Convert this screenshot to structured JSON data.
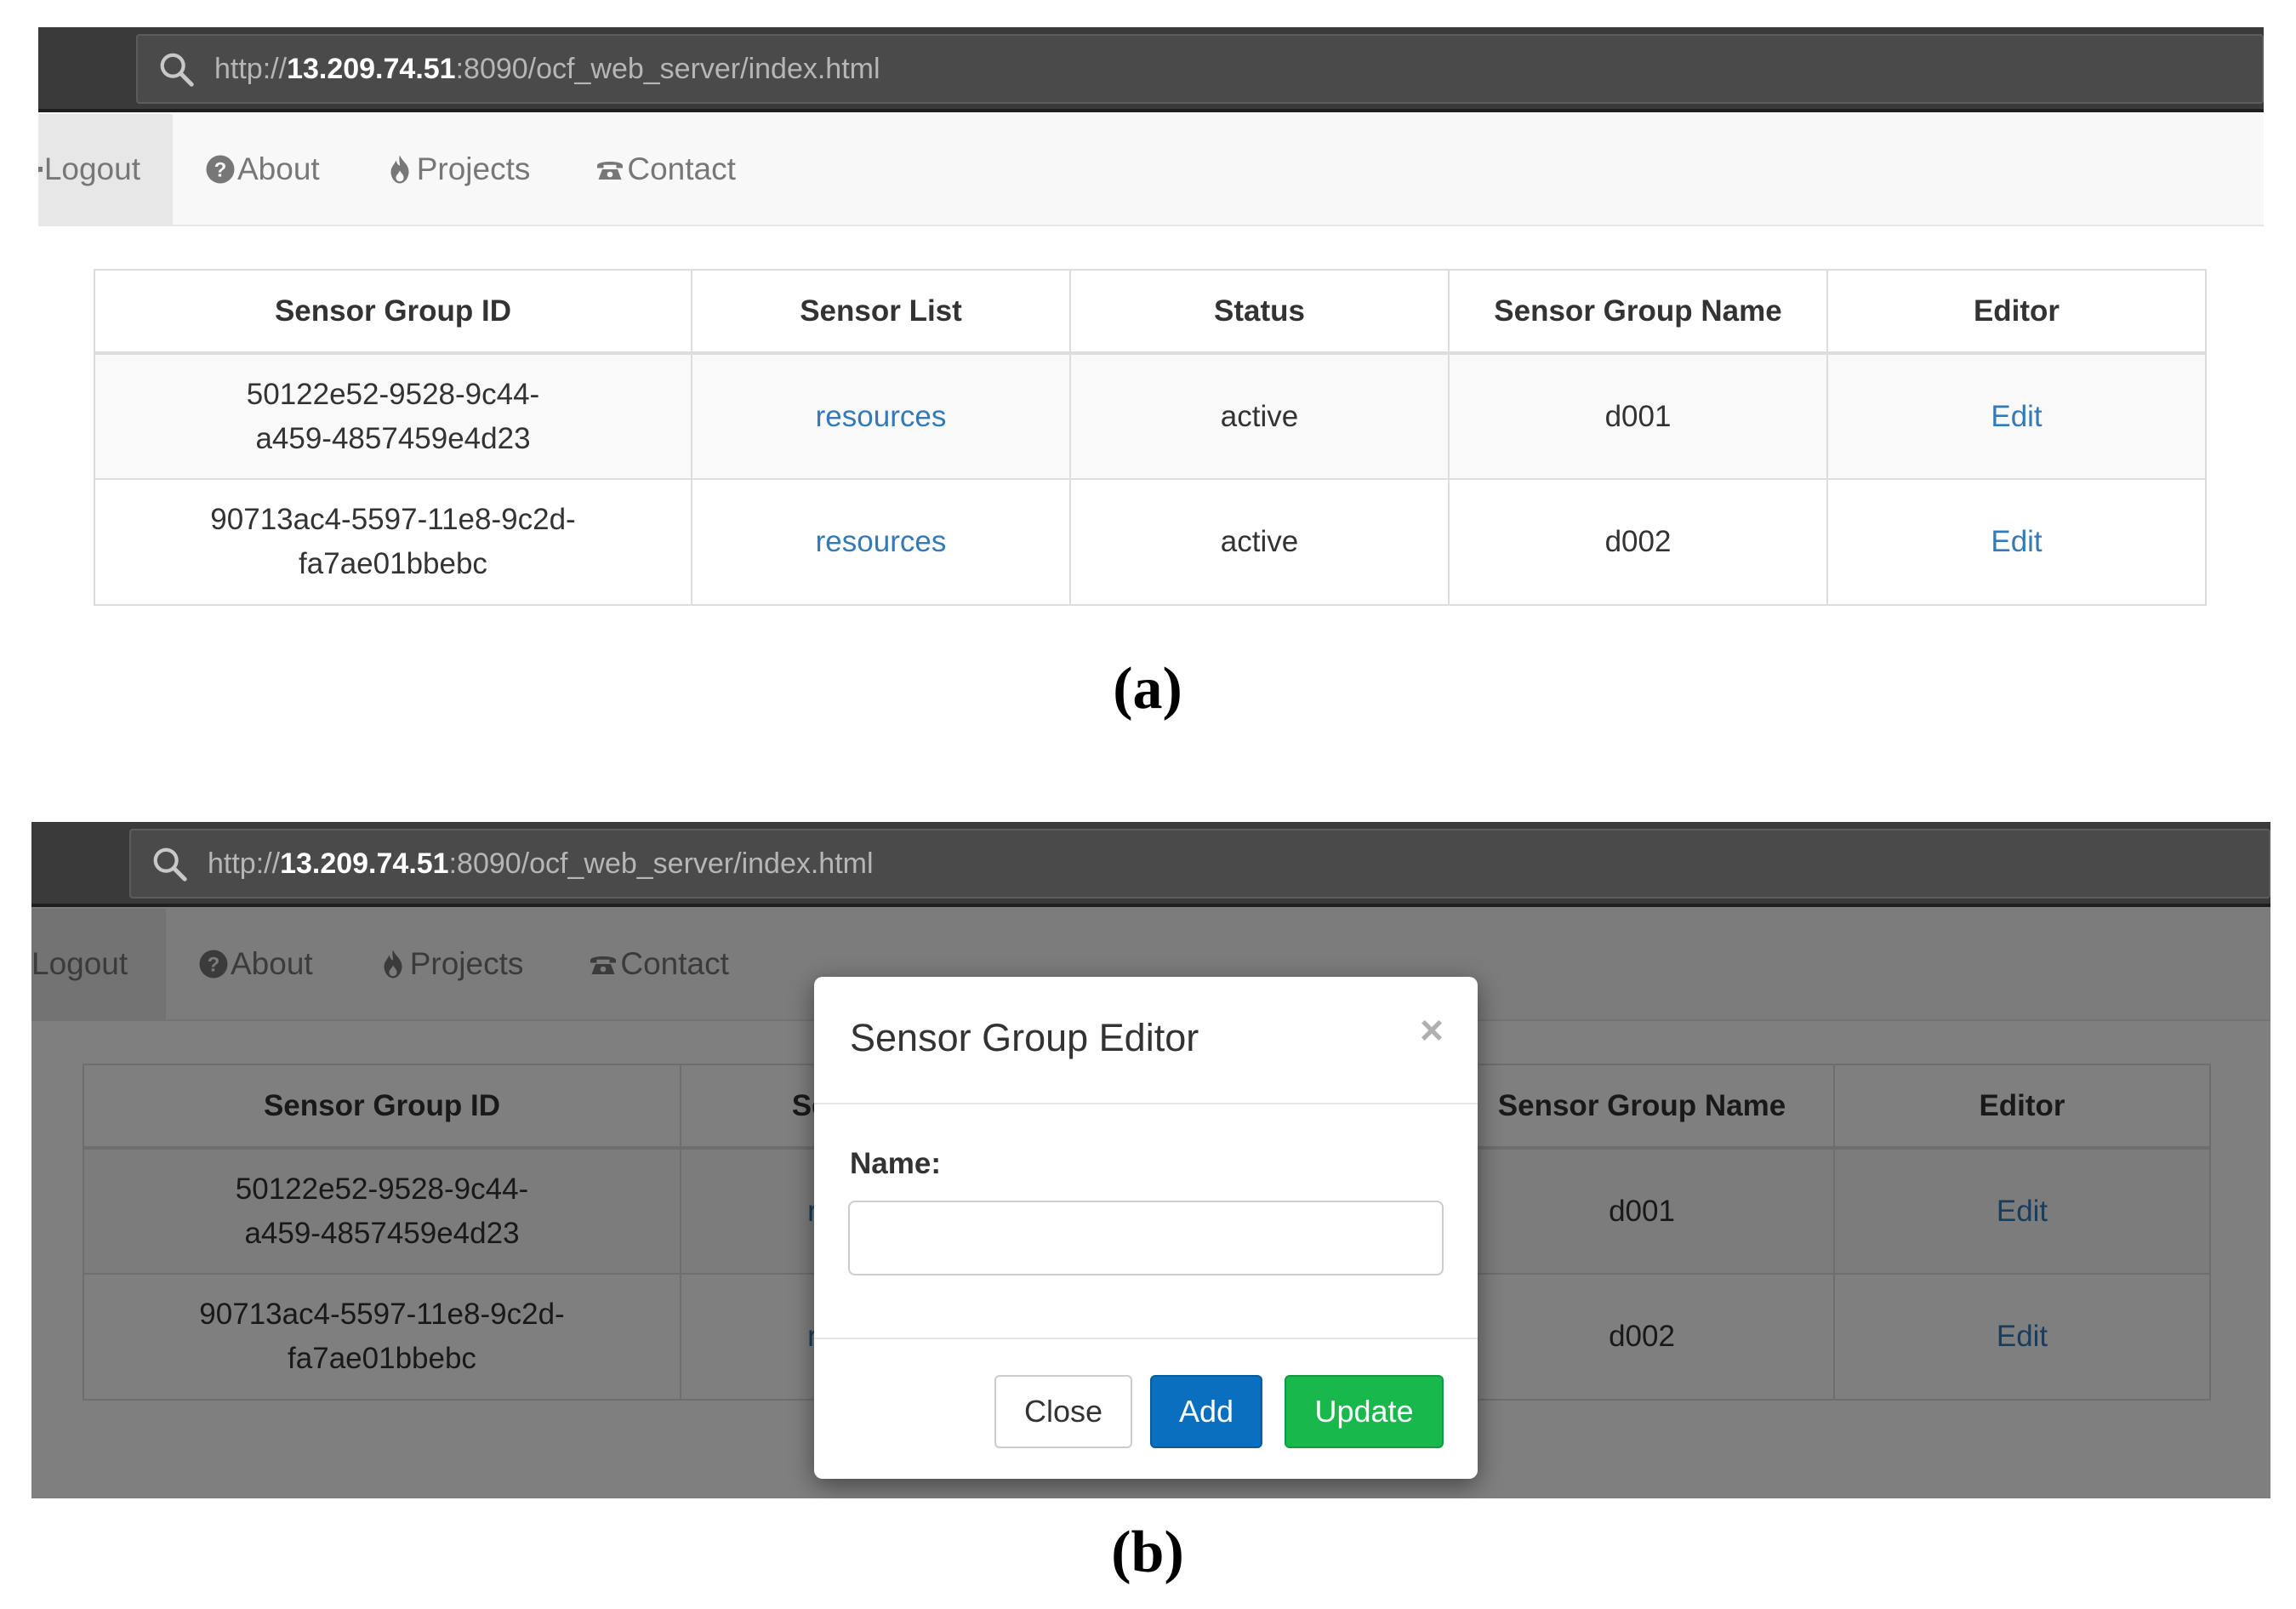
{
  "browser": {
    "url_prefix": "http://",
    "url_host": "13.209.74.51",
    "url_path": ":8090/ocf_web_server/index.html"
  },
  "nav": {
    "items": [
      {
        "label": "Logout",
        "icon": "logout-icon",
        "active": true
      },
      {
        "label": "About",
        "icon": "question-circle-icon"
      },
      {
        "label": "Projects",
        "icon": "fire-icon"
      },
      {
        "label": "Contact",
        "icon": "phone-icon"
      }
    ]
  },
  "table": {
    "headers": [
      "Sensor Group ID",
      "Sensor List",
      "Status",
      "Sensor Group Name",
      "Editor"
    ],
    "rows": [
      {
        "id_line1": "50122e52-9528-9c44-",
        "id_line2": "a459-4857459e4d23",
        "sensor_list": "resources",
        "status": "active",
        "name": "d001",
        "editor": "Edit"
      },
      {
        "id_line1": "90713ac4-5597-11e8-9c2d-",
        "id_line2": "fa7ae01bbebc",
        "sensor_list": "resources",
        "status": "active",
        "name": "d002",
        "editor": "Edit"
      }
    ]
  },
  "modal": {
    "title": "Sensor Group Editor",
    "close_glyph": "×",
    "field_label": "Name:",
    "name_value": "",
    "buttons": {
      "close": "Close",
      "add": "Add",
      "update": "Update"
    }
  },
  "captions": {
    "a": "(a)",
    "b": "(b)"
  },
  "colors": {
    "link": "#337ab7",
    "add_button": "#0a6fbf",
    "update_button": "#18b84c",
    "browser_bar": "#3a3a3a"
  }
}
